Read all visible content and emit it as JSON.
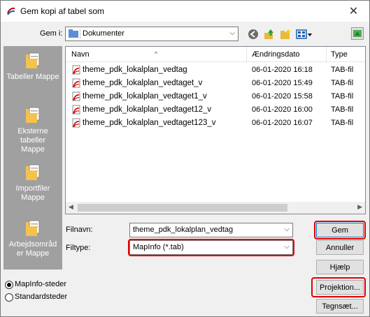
{
  "window": {
    "title": "Gem kopi af tabel som"
  },
  "lookin": {
    "label": "Gem i:",
    "value": "Dokumenter"
  },
  "places": [
    {
      "label": "Tabeller Mappe"
    },
    {
      "label": "Eksterne tabeller Mappe"
    },
    {
      "label": "Importfiler Mappe"
    },
    {
      "label": "Arbejdsområd er Mappe"
    }
  ],
  "columns": {
    "name": "Navn",
    "date": "Ændringsdato",
    "type": "Type"
  },
  "files": [
    {
      "name": "theme_pdk_lokalplan_vedtag",
      "date": "06-01-2020 16:18",
      "type": "TAB-fil"
    },
    {
      "name": "theme_pdk_lokalplan_vedtaget_v",
      "date": "06-01-2020 15:49",
      "type": "TAB-fil"
    },
    {
      "name": "theme_pdk_lokalplan_vedtaget1_v",
      "date": "06-01-2020 15:58",
      "type": "TAB-fil"
    },
    {
      "name": "theme_pdk_lokalplan_vedtaget12_v",
      "date": "06-01-2020 16:00",
      "type": "TAB-fil"
    },
    {
      "name": "theme_pdk_lokalplan_vedtaget123_v",
      "date": "06-01-2020 16:07",
      "type": "TAB-fil"
    }
  ],
  "filename": {
    "label": "Filnavn:",
    "value": "theme_pdk_lokalplan_vedtag"
  },
  "filetype": {
    "label": "Filtype:",
    "value": "MapInfo (*.tab)"
  },
  "buttons": {
    "save": "Gem",
    "cancel": "Annuller",
    "help": "Hjælp",
    "projection": "Projektion...",
    "charset": "Tegnsæt..."
  },
  "radios": [
    {
      "label": "MapInfo-steder",
      "checked": true
    },
    {
      "label": "Standardsteder",
      "checked": false
    }
  ],
  "colors": {
    "highlight": "#e00000",
    "sidebar": "#a0a0a0",
    "accent": "#0078d7"
  }
}
